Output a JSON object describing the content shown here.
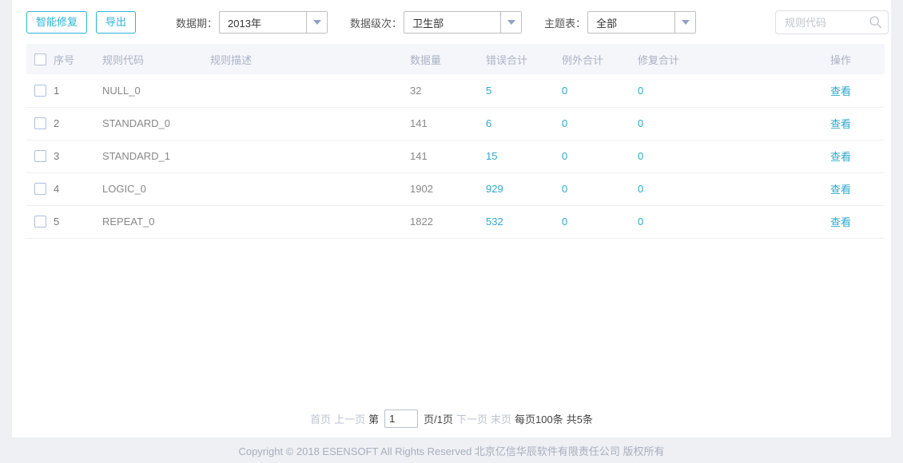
{
  "toolbar": {
    "buttons": [
      {
        "label": "智能修复",
        "name": "smart-repair-button"
      },
      {
        "label": "导出",
        "name": "export-button"
      }
    ],
    "filters": [
      {
        "label": "数据期：",
        "value": "2013年",
        "icon": "chevron-down-icon"
      },
      {
        "label": "数据级次：",
        "value": "卫生部",
        "icon": "chevron-down-icon"
      },
      {
        "label": "主题表：",
        "value": "全部",
        "icon": "chevron-down-icon"
      }
    ],
    "search": {
      "placeholder": "规则代码",
      "value": "",
      "icon": "search-icon"
    }
  },
  "table": {
    "columns": [
      "序号",
      "规则代码",
      "规则描述",
      "数据量",
      "错误合计",
      "例外合计",
      "修复合计",
      "操作"
    ],
    "rows": [
      {
        "seq": "1",
        "code": "NULL_0",
        "desc": "",
        "count": "32",
        "errors": "5",
        "exceptions": "0",
        "repairs": "0",
        "action": "查看"
      },
      {
        "seq": "2",
        "code": "STANDARD_0",
        "desc": "",
        "count": "141",
        "errors": "6",
        "exceptions": "0",
        "repairs": "0",
        "action": "查看"
      },
      {
        "seq": "3",
        "code": "STANDARD_1",
        "desc": "",
        "count": "141",
        "errors": "15",
        "exceptions": "0",
        "repairs": "0",
        "action": "查看"
      },
      {
        "seq": "4",
        "code": "LOGIC_0",
        "desc": "",
        "count": "1902",
        "errors": "929",
        "exceptions": "0",
        "repairs": "0",
        "action": "查看"
      },
      {
        "seq": "5",
        "code": "REPEAT_0",
        "desc": "",
        "count": "1822",
        "errors": "532",
        "exceptions": "0",
        "repairs": "0",
        "action": "查看"
      }
    ]
  },
  "pagination": {
    "first": "首页",
    "prev": "上一页",
    "page_prefix": "第",
    "page_value": "1",
    "page_suffix": "页/1页",
    "next": "下一页",
    "last": "末页",
    "per_page": "每页100条",
    "total": "共5条"
  },
  "footer": {
    "text": "Copyright © 2018 ESENSOFT All Rights Reserved 北京亿信华辰软件有限责任公司 版权所有"
  },
  "colors": {
    "accent": "#29b6d8",
    "link": "#2fa8cc",
    "page_bg": "#eef0f4",
    "header_bg": "#f5f6fa"
  }
}
